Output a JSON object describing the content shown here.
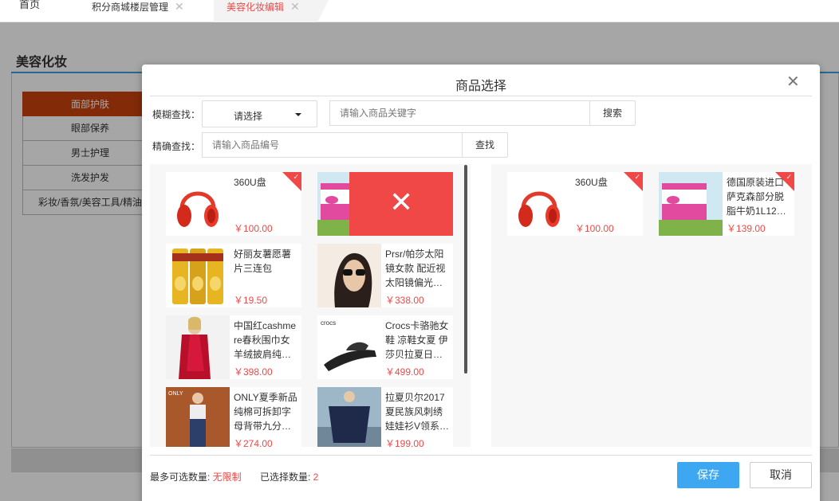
{
  "tabs": {
    "home": "首页",
    "floor_mgmt": "积分商城楼层管理",
    "beauty_edit": "美容化妆编辑"
  },
  "page": {
    "title": "美容化妆",
    "categories": [
      "面部护肤",
      "眼部保养",
      "男士护理",
      "洗发护发",
      "彩妆/香氛/美容工具/精油"
    ]
  },
  "modal": {
    "title": "商品选择",
    "fuzzy_label": "模糊查找：",
    "select_value": "请选择",
    "keyword_placeholder": "请输入商品关键字",
    "search_btn": "搜索",
    "exact_label": "精确查找：",
    "code_placeholder": "请输入商品编号",
    "find_btn": "查找",
    "left_items": [
      {
        "name": "360U盘",
        "price": "￥100.00",
        "thumb": "headphones-image"
      },
      {
        "name": "",
        "price": "",
        "thumb": "milk-box-image"
      },
      {
        "name": "好丽友薯愿薯片三连包",
        "price": "￥19.50",
        "thumb": "chips-image"
      },
      {
        "name": "Prsr/帕莎太阳镜女款 配近视太阳镜偏光…",
        "price": "￥338.00",
        "thumb": "sunglasses-image"
      },
      {
        "name": "中国红cashmere春秋围巾女羊绒披肩纯…",
        "price": "￥398.00",
        "thumb": "scarf-image"
      },
      {
        "name": "Crocs卡骆驰女鞋 凉鞋女夏 伊莎贝拉夏日…",
        "price": "￥499.00",
        "thumb": "sandal-image"
      },
      {
        "name": "ONLY夏季新品纯棉可拆卸字母背带九分…",
        "price": "￥274.00",
        "thumb": "overalls-image"
      },
      {
        "name": "拉夏贝尔2017夏民族风刺绣娃娃衫V领系…",
        "price": "￥199.00",
        "thumb": "blouse-image"
      }
    ],
    "right_items": [
      {
        "name": "360U盘",
        "price": "￥100.00",
        "thumb": "headphones-image"
      },
      {
        "name": "德国原装进口萨克森部分脱脂牛奶1L12…",
        "price": "￥139.00",
        "thumb": "milk-box-image"
      }
    ],
    "max_label": "最多可选数量: ",
    "max_value": "无限制",
    "selected_label": "已选择数量: ",
    "selected_value": "2",
    "save_btn": "保存",
    "cancel_btn": "取消"
  },
  "colors": {
    "accent_red": "#f04747",
    "save_blue": "#3da7f2",
    "active_category": "#c9410d"
  }
}
